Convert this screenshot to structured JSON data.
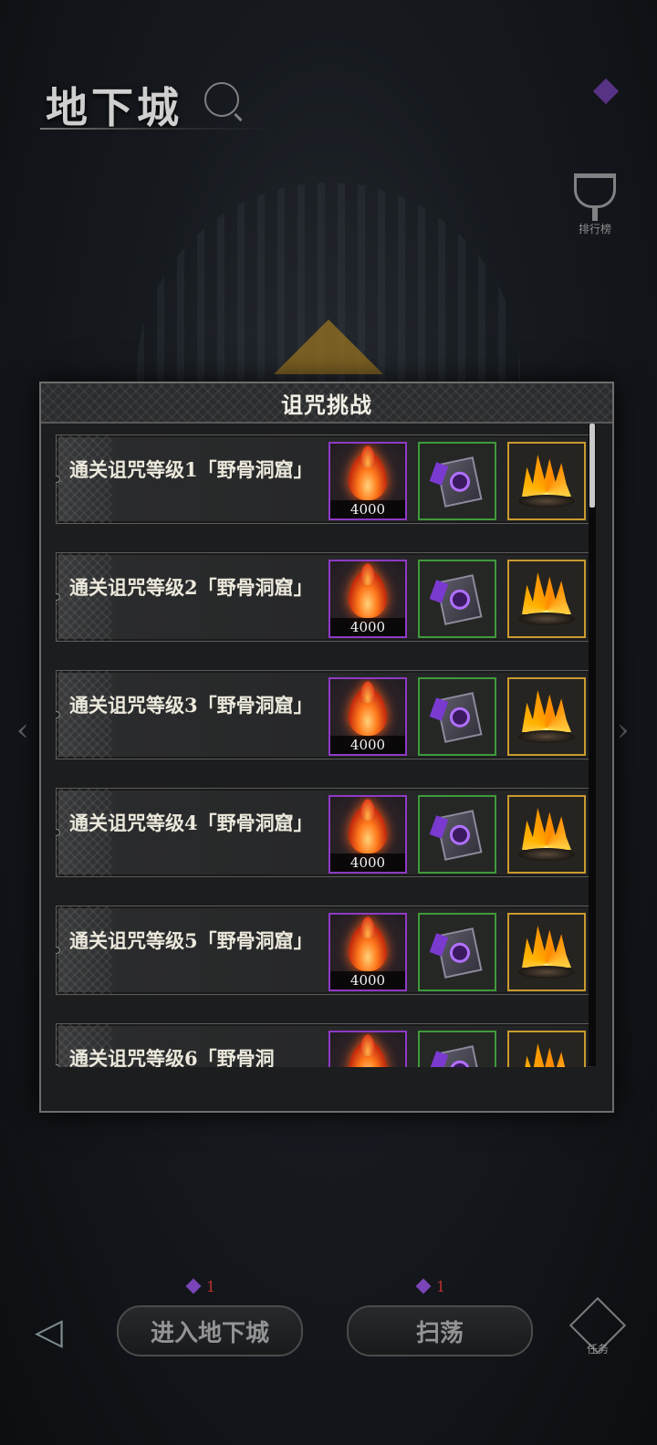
{
  "background": {
    "title": "地下城",
    "rank_label": "排行榜",
    "enter_button": "进入地下城",
    "sweep_button": "扫荡",
    "enter_cost": "1",
    "sweep_cost": "1",
    "task_label": "任务"
  },
  "modal": {
    "title": "诅咒挑战",
    "rows": [
      {
        "label": "通关诅咒等级1「野骨洞窟」",
        "reward_count": "4000"
      },
      {
        "label": "通关诅咒等级2「野骨洞窟」",
        "reward_count": "4000"
      },
      {
        "label": "通关诅咒等级3「野骨洞窟」",
        "reward_count": "4000"
      },
      {
        "label": "通关诅咒等级4「野骨洞窟」",
        "reward_count": "4000"
      },
      {
        "label": "通关诅咒等级5「野骨洞窟」",
        "reward_count": "4000"
      },
      {
        "label": "通关诅咒等级6「野骨洞",
        "reward_count": ""
      }
    ]
  },
  "colors": {
    "slot_purple": "#8e3ac4",
    "slot_green": "#3f9a3a",
    "slot_gold": "#c99a2e"
  }
}
